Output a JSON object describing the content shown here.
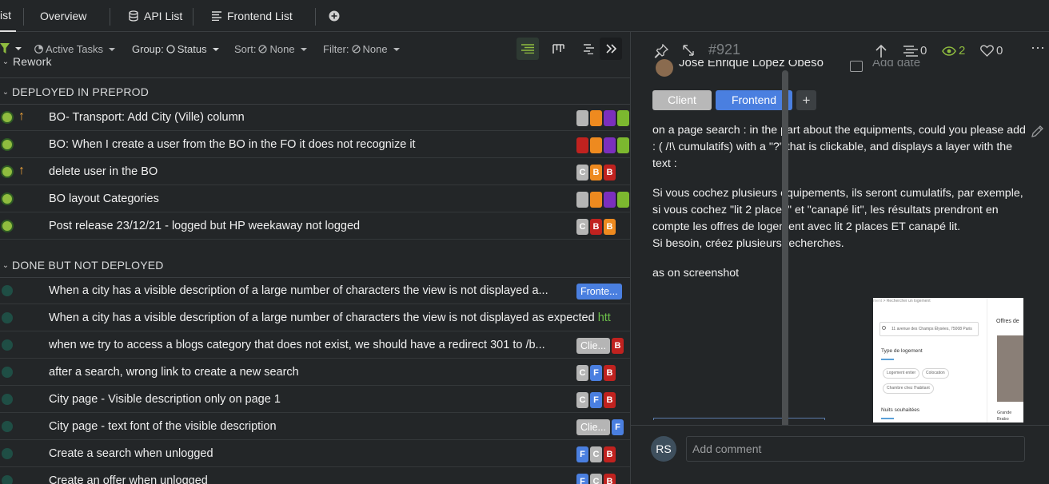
{
  "nav": {
    "tab_partial": "ist",
    "overview": "Overview",
    "api_list": "API List",
    "frontend_list": "Frontend List",
    "add_icon": "plus-circle-icon"
  },
  "toolbar": {
    "active_tasks": "Active Tasks",
    "group_key": "Group:",
    "group_val": "Status",
    "sort_key": "Sort:",
    "sort_val": "None",
    "filter_key": "Filter:",
    "filter_val": "None"
  },
  "groups": {
    "rework": "Rework",
    "deployed": "DEPLOYED IN PREPROD",
    "done": "DONE BUT NOT DEPLOYED"
  },
  "deployed_rows": [
    {
      "title": "BO- Transport: Add City (Ville) column",
      "priority": "up"
    },
    {
      "title": "BO: When I create a user from the BO in the FO it does not recognize it",
      "priority": ""
    },
    {
      "title": "delete user in the BO",
      "priority": "up"
    },
    {
      "title": "BO layout Categories",
      "priority": ""
    },
    {
      "title": "Post release 23/12/21 - logged but HP weekaway not logged",
      "priority": ""
    }
  ],
  "done_rows": [
    {
      "title": "When a city has a visible description of a large number of characters the view is not displayed a...",
      "link": ""
    },
    {
      "title": "When a city has a visible description of a large number of characters the view is not displayed as expected ",
      "link": "htt"
    },
    {
      "title": "when we try to access a blogs category that does not exist, we should have a redirect 301 to /b...",
      "link": ""
    },
    {
      "title": "after a search, wrong link to create a new search",
      "link": ""
    },
    {
      "title": "City page - Visible description only on page 1",
      "link": ""
    },
    {
      "title": "City page - text font of the visible description",
      "link": ""
    },
    {
      "title": "Create a search when unlogged",
      "link": ""
    },
    {
      "title": "Create an offer when unlogged",
      "link": ""
    }
  ],
  "tags": {
    "c": "C",
    "b": "B",
    "f": "F",
    "frontend_short": "Fronte...",
    "client_short": "Clie..."
  },
  "panel": {
    "id": "#921",
    "assignee": "José Enrique López Obeso",
    "add_date": "Add date",
    "comments_count": "0",
    "watchers_count": "2",
    "likes_count": "0",
    "chip_client": "Client",
    "chip_frontend": "Frontend",
    "chip_add": "+"
  },
  "description": {
    "p1": "on a page search : in the part about the equipments, could you please add : ( /!\\ cumulatifs) with a \"?\" that is clickable, and displays a layer with the text :",
    "p2a": "Si vous cochez plusieurs équipements, ils seront cumulatifs, par exemple, si vous cochez \"lit 2 places\" et \"canapé lit\", les résultats prendront en compte les offres de logement avec lit 2 places ET canapé lit.",
    "p2b": "Si besoin, créez plusieurs recherches.",
    "p3": "as on screenshot"
  },
  "screenshot": {
    "breadcrumb": "> Rechercher un logement",
    "search_text": "11 avenue des Champs Élysées, 75008 Paris",
    "type_label": "Type de logement",
    "opt1": "Logement entier",
    "opt2": "Colocation",
    "opt3": "Chambre chez l'habitant",
    "nights_label": "Nuits souhaitées",
    "offers_label": "Offres de",
    "side_text": "Grande Brabo"
  },
  "comment": {
    "avatar": "RS",
    "placeholder": "Add comment"
  },
  "colors": {
    "bg": "#232628",
    "accent_green": "#8fbc3f",
    "tag_blue": "#4a7fe0",
    "tag_red": "#c0221f",
    "tag_orange": "#ee8a1f",
    "tag_purple": "#7b2fbd",
    "tag_gray": "#b5b5b5"
  }
}
